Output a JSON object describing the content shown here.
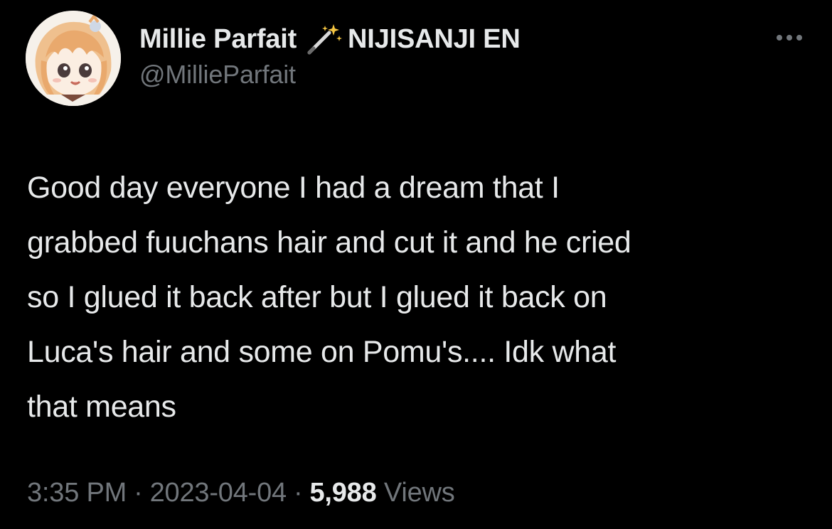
{
  "author": {
    "display_name": "Millie Parfait",
    "affiliation": "NIJISANJI EN",
    "handle": "@MillieParfait",
    "badge_icon": "magic-wand-sparkle-icon",
    "avatar": "anime-girl-avatar"
  },
  "actions": {
    "more_icon": "more-options-dots-icon"
  },
  "tweet": {
    "lines": [
      "Good day everyone I had a dream that I",
      "grabbed fuuchans hair and cut it and he cried",
      "so I glued it back after but I glued it back on",
      "Luca's hair and some on Pomu's.... Idk what",
      "that means"
    ]
  },
  "meta": {
    "time": "3:35 PM",
    "separator": "·",
    "date": "2023-04-04",
    "views_count": "5,988",
    "views_label": "Views"
  },
  "colors": {
    "background": "#000000",
    "primary_text": "#e7e9ea",
    "secondary_text": "#71767b"
  }
}
